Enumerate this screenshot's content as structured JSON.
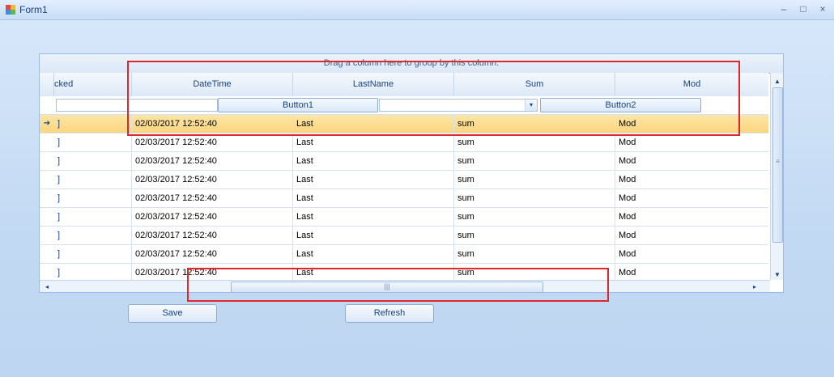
{
  "window": {
    "title": "Form1",
    "controls": [
      "–",
      "□",
      "×"
    ]
  },
  "grid": {
    "group_panel_text": "Drag a column here to group by this column.",
    "columns": [
      "cked",
      "DateTime",
      "LastName",
      "Sum",
      "Mod"
    ],
    "filter_row": {
      "button1_label": "Button1",
      "button2_label": "Button2",
      "combo_arrow": "▾"
    },
    "rows": [
      {
        "selected": true,
        "indicator": "➔",
        "checked": "]",
        "datetime": "02/03/2017 12:52:40",
        "lastname": "Last",
        "sum": "sum",
        "mod": "Mod"
      },
      {
        "selected": false,
        "indicator": "",
        "checked": "]",
        "datetime": "02/03/2017 12:52:40",
        "lastname": "Last",
        "sum": "sum",
        "mod": "Mod"
      },
      {
        "selected": false,
        "indicator": "",
        "checked": "]",
        "datetime": "02/03/2017 12:52:40",
        "lastname": "Last",
        "sum": "sum",
        "mod": "Mod"
      },
      {
        "selected": false,
        "indicator": "",
        "checked": "]",
        "datetime": "02/03/2017 12:52:40",
        "lastname": "Last",
        "sum": "sum",
        "mod": "Mod"
      },
      {
        "selected": false,
        "indicator": "",
        "checked": "]",
        "datetime": "02/03/2017 12:52:40",
        "lastname": "Last",
        "sum": "sum",
        "mod": "Mod"
      },
      {
        "selected": false,
        "indicator": "",
        "checked": "]",
        "datetime": "02/03/2017 12:52:40",
        "lastname": "Last",
        "sum": "sum",
        "mod": "Mod"
      },
      {
        "selected": false,
        "indicator": "",
        "checked": "]",
        "datetime": "02/03/2017 12:52:40",
        "lastname": "Last",
        "sum": "sum",
        "mod": "Mod"
      },
      {
        "selected": false,
        "indicator": "",
        "checked": "]",
        "datetime": "02/03/2017 12:52:40",
        "lastname": "Last",
        "sum": "sum",
        "mod": "Mod"
      },
      {
        "selected": false,
        "indicator": "",
        "checked": "]",
        "datetime": "02/03/2017 12:52:40",
        "lastname": "Last",
        "sum": "sum",
        "mod": "Mod"
      }
    ],
    "scroll": {
      "up": "▲",
      "down": "▼",
      "left": "◂",
      "right": "▸",
      "vgrip": "≡",
      "hgrip": "|||"
    }
  },
  "buttons": {
    "save_label": "Save",
    "refresh_label": "Refresh"
  },
  "colors": {
    "selected_row": "#fbd57f",
    "annotation": "#e0282c"
  }
}
